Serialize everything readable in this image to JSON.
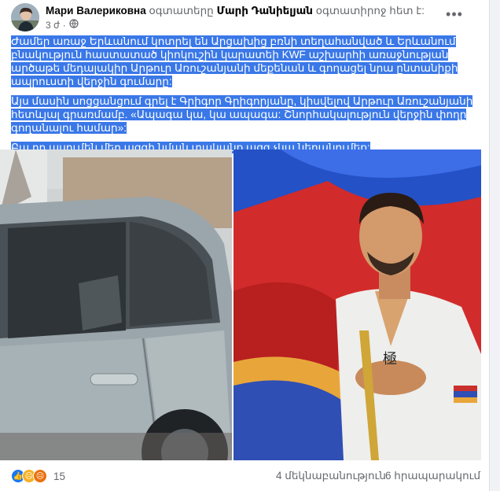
{
  "header": {
    "author": "Мари Валериковна",
    "action_prefix": " օգտատերը ",
    "tagged": "Մարի Դանիելյան",
    "action_suffix": " օգտատիրոջ հետ է:",
    "time": "3 ժ",
    "separator": "·",
    "more_icon": "ellipsis-icon",
    "privacy_icon": "globe-icon"
  },
  "post": {
    "paragraphs": [
      "Ժամեր առաջ Երևանում կոտրել են Արցախից բռնի տեղահանված և Երևանում բնակություն հաստատած կիոկուշին կարատեի KWF աշխարհի առաջնության արծաթե մեդալակիր Արթուր Առուշանյանի մեքենան և գողացել նրա ընտանիքի ապրուստի վերջին գումարը:",
      "Այս մասին սոցցանցում գրել է Գրիգոր Գրիգորյանը, կիսվելով Արթուր Առուշանյանի հետևյալ գրառմամբ. «Ապագա կա, կա ապագա: Շնորհակալություն վերջին փողը գողանալու համար»:",
      "Բա որ ասումեն մեր ազգի նման տականք ազգ չկա նեղանումեք:"
    ]
  },
  "photos": {
    "left_alt": "car photo",
    "right_alt": "athlete photo"
  },
  "footer": {
    "reaction_count": "15",
    "comments": "4 մեկնաբանություն",
    "shares": "6 հրապարակում",
    "reaction_icons": [
      "like-icon",
      "sad-icon",
      "angry-icon"
    ]
  },
  "colors": {
    "highlight": "#3a78e8",
    "like": "#1877f2",
    "sad": "#f7b125",
    "angry": "#e9710f"
  }
}
